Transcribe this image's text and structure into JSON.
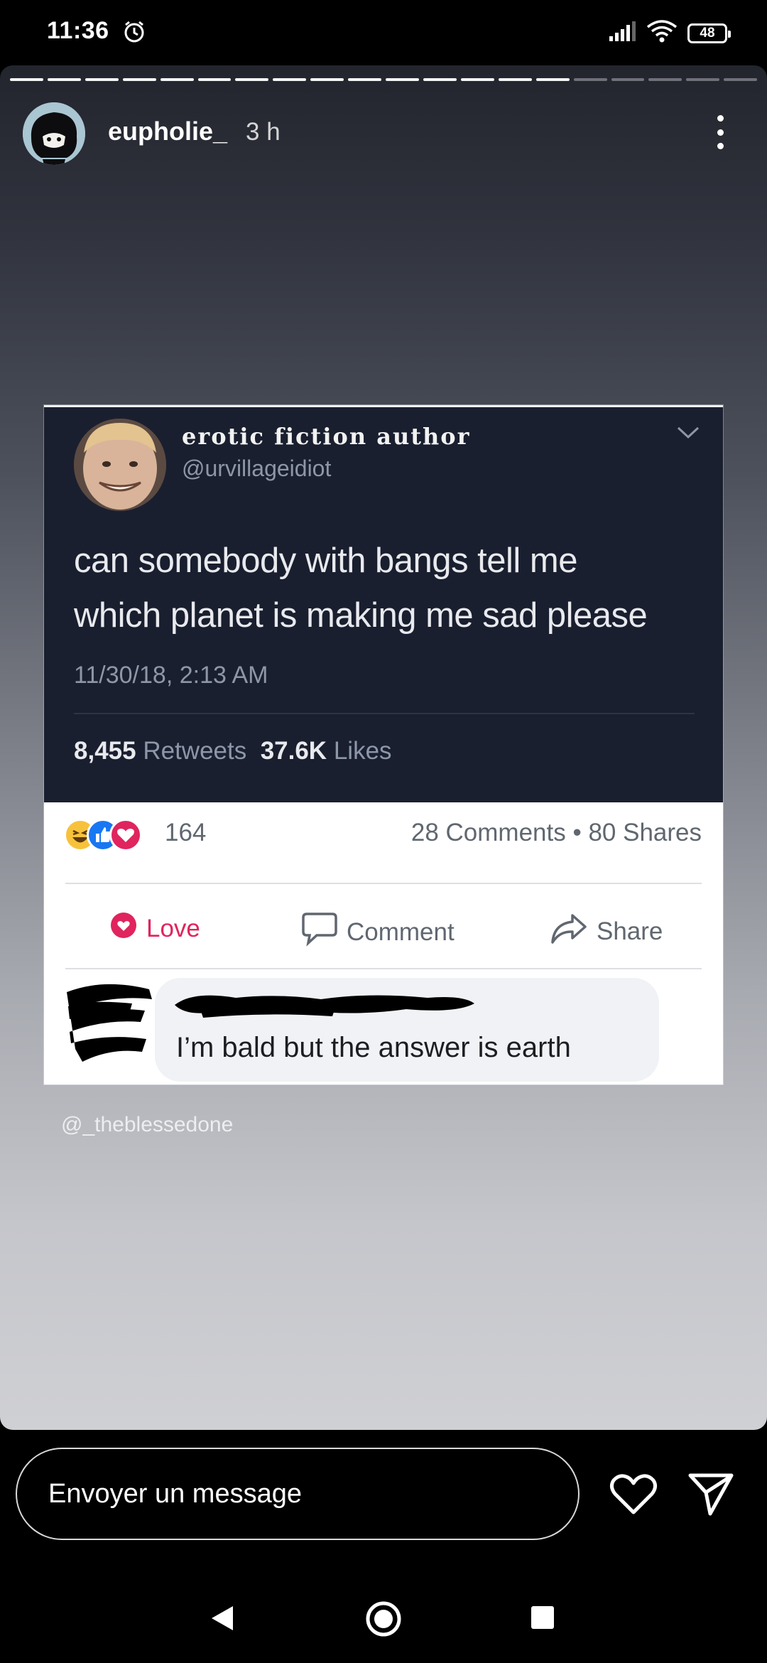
{
  "status_bar": {
    "time": "11:36",
    "battery": "48",
    "icons": [
      "alarm-icon",
      "signal-icon",
      "wifi-icon",
      "battery-icon"
    ]
  },
  "story": {
    "progress": {
      "segments": 20,
      "completed": 15
    },
    "user": {
      "username": "eupholie_",
      "time_ago": "3 h"
    },
    "credit": "@_theblessedone"
  },
  "tweet": {
    "display_name": "erotic fiction author",
    "handle": "@urvillageidiot",
    "text_lines": [
      "can somebody with bangs tell me",
      "which planet is making me sad please"
    ],
    "date": "11/30/18, 2:13 AM",
    "retweets_count": "8,455",
    "retweets_label": "Retweets",
    "likes_count": "37.6K",
    "likes_label": "Likes"
  },
  "facebook": {
    "reaction_count": "164",
    "comments_shares": "28 Comments • 80 Shares",
    "actions": {
      "love": "Love",
      "comment": "Comment",
      "share": "Share"
    },
    "comment_text": "I’m bald but the answer is earth"
  },
  "message_bar": {
    "placeholder": "Envoyer un message"
  },
  "colors": {
    "tweet_bg": "#1a1f2f",
    "fb_text": "#606770",
    "love_red": "#e0245e",
    "like_blue": "#1877f2"
  }
}
